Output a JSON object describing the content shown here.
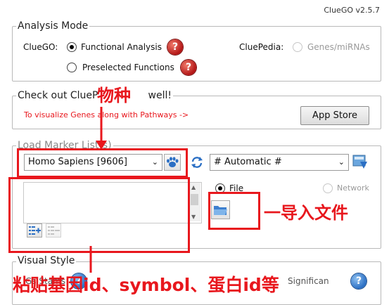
{
  "app": {
    "version": "ClueGO v2.5.7"
  },
  "analysis_mode": {
    "title": "Analysis Mode",
    "cluego_label": "ClueGO:",
    "option_functional": "Functional Analysis",
    "option_preselected": "Preselected Functions",
    "cluepedia_label": "CluePedia:",
    "option_genes_mirnas": "Genes/miRNAs",
    "help_glyph": "?"
  },
  "cluepedia_panel": {
    "title_visible_a": "Check out ClueP",
    "title_visible_b": "well!",
    "message": "To visualize Genes along with Pathways   ->",
    "app_store_button": "App Store"
  },
  "load_marker": {
    "title": "Load Marker List(s)",
    "organism_selected": "Homo Sapiens [9606]",
    "id_type_selected": "# Automatic #",
    "radio_file": "File",
    "radio_network": "Network"
  },
  "visual_style": {
    "title": "Visual Style",
    "visible_text_left": "Gs Stams",
    "visible_text_right": "Significan",
    "help_glyph": "?"
  },
  "annotations": {
    "species": "物种",
    "import_file": "一导入文件",
    "paste_ids": "粘贴基因id、symbol、蛋白id等"
  },
  "colors": {
    "annotation_red": "#e8171d",
    "message_red": "#e8171d",
    "panel_border": "#b9b9b9",
    "help_icon": "#c0201a",
    "paw_blue": "#2b6fc4"
  }
}
